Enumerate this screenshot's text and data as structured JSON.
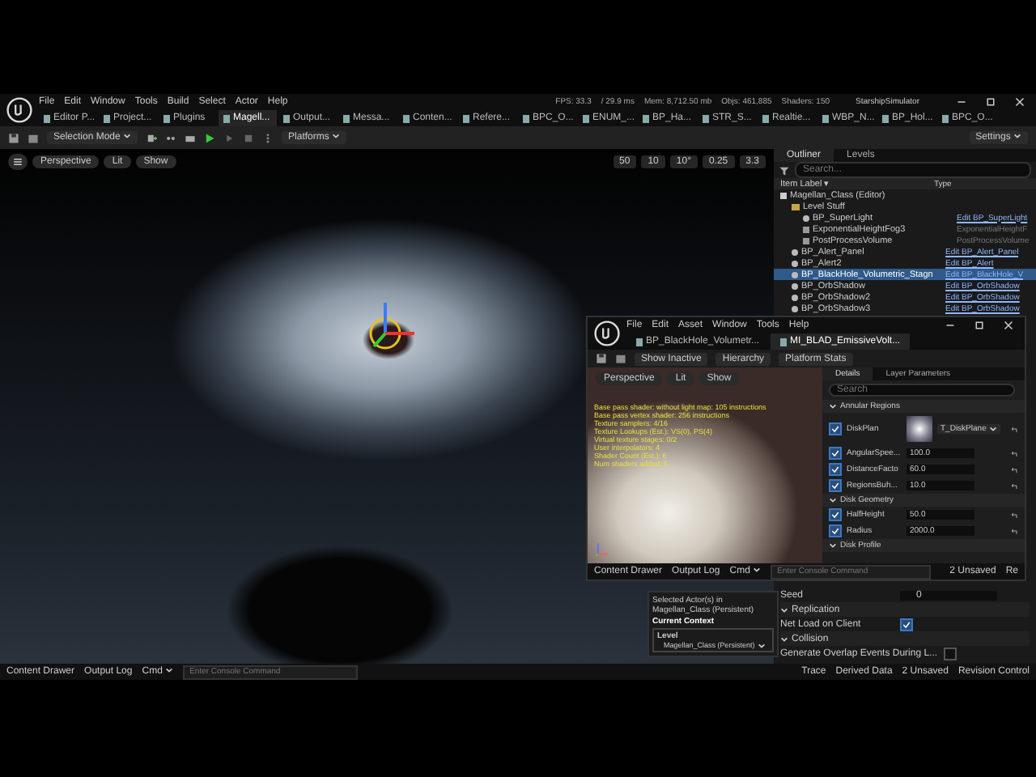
{
  "menu": [
    "File",
    "Edit",
    "Window",
    "Tools",
    "Build",
    "Select",
    "Actor",
    "Help"
  ],
  "stats": [
    "FPS: 33.3",
    "/ 29.9 ms",
    "Mem: 8,712.50 mb",
    "Objs: 461,885",
    "Shaders: 150"
  ],
  "project": "StarshipSimulator",
  "doc_tabs": [
    {
      "label": "Editor P...",
      "selected": false
    },
    {
      "label": "Project...",
      "selected": false
    },
    {
      "label": "Plugins",
      "selected": false
    },
    {
      "label": "Magell...",
      "selected": true
    },
    {
      "label": "Output...",
      "selected": false
    },
    {
      "label": "Messa...",
      "selected": false
    },
    {
      "label": "Conten...",
      "selected": false
    },
    {
      "label": "Refere...",
      "selected": false
    },
    {
      "label": "BPC_O...",
      "selected": false
    },
    {
      "label": "ENUM_...",
      "selected": false
    },
    {
      "label": "BP_Ha...",
      "selected": false
    },
    {
      "label": "STR_S...",
      "selected": false
    },
    {
      "label": "Realtie...",
      "selected": false
    },
    {
      "label": "WBP_N...",
      "selected": false
    },
    {
      "label": "BP_Hol...",
      "selected": false
    },
    {
      "label": "BPC_O...",
      "selected": false
    }
  ],
  "toolbar": {
    "mode": "Selection Mode",
    "platforms": "Platforms",
    "settings": "Settings"
  },
  "viewport": {
    "buttons": [
      "Perspective",
      "Lit",
      "Show"
    ],
    "readouts": [
      "50",
      "10",
      "10°",
      "0.25",
      "3.3"
    ]
  },
  "outliner": {
    "tabs": [
      {
        "label": "Outliner",
        "selected": true
      },
      {
        "label": "Levels",
        "selected": false
      }
    ],
    "search_placeholder": "Search...",
    "columns": [
      "Item Label ▾",
      "Type"
    ],
    "items": [
      {
        "label": "Magellan_Class (Editor)",
        "kind": "level",
        "selected": false,
        "children": [
          {
            "label": "Level Stuff",
            "kind": "folder",
            "selected": false,
            "children": [
              {
                "label": "BP_SuperLight",
                "kind": "actor",
                "type": "Edit BP_SuperLight",
                "link": true,
                "selected": false
              },
              {
                "label": "ExponentialHeightFog3",
                "kind": "fog",
                "type": "ExponentialHeightF",
                "link": false,
                "selected": false
              },
              {
                "label": "PostProcessVolume",
                "kind": "volume",
                "type": "PostProcessVolume",
                "link": false,
                "selected": false
              }
            ]
          },
          {
            "label": "BP_Alert_Panel",
            "kind": "actor",
            "type": "Edit BP_Alert_Panel",
            "link": true,
            "selected": false
          },
          {
            "label": "BP_Alert2",
            "kind": "actor",
            "type": "Edit BP_Alert",
            "link": true,
            "selected": false
          },
          {
            "label": "BP_BlackHole_Volumetric_Stagn",
            "kind": "actor",
            "type": "Edit BP_BlackHole_V",
            "link": true,
            "selected": true
          },
          {
            "label": "BP_OrbShadow",
            "kind": "actor",
            "type": "Edit BP_OrbShadow",
            "link": true,
            "selected": false
          },
          {
            "label": "BP_OrbShadow2",
            "kind": "actor",
            "type": "Edit BP_OrbShadow",
            "link": true,
            "selected": false
          },
          {
            "label": "BP_OrbShadow3",
            "kind": "actor",
            "type": "Edit BP_OrbShadow",
            "link": true,
            "selected": false
          }
        ]
      }
    ]
  },
  "details": [
    {
      "kind": "value",
      "label": "Seed",
      "value": "0"
    },
    {
      "kind": "section",
      "label": "Replication"
    },
    {
      "kind": "check",
      "label": "Net Load on Client",
      "checked": true
    },
    {
      "kind": "section",
      "label": "Collision"
    },
    {
      "kind": "check",
      "label": "Generate Overlap Events During L...",
      "checked": false
    }
  ],
  "status_bar": {
    "left": [
      "Content Drawer",
      "Output Log"
    ],
    "cmd": "Cmd",
    "console_placeholder": "Enter Console Command",
    "right": [
      "Trace",
      "Derived Data",
      "2 Unsaved",
      "Revision Control"
    ]
  },
  "popup": {
    "text": "Selected Actor(s) in Magellan_Class (Persistent)",
    "heading": "Current Context",
    "level_label": "Level",
    "level_value": "Magellan_Class (Persistent)"
  },
  "material_editor": {
    "menu": [
      "File",
      "Edit",
      "Asset",
      "Window",
      "Tools",
      "Help"
    ],
    "tabs": [
      {
        "label": "BP_BlackHole_Volumetr...",
        "selected": false
      },
      {
        "label": "MI_BLAD_EmissiveVolt...",
        "selected": true
      }
    ],
    "toolbar": [
      "Show Inactive",
      "Hierarchy",
      "Platform Stats"
    ],
    "viewport_buttons": [
      "Perspective",
      "Lit",
      "Show"
    ],
    "stat_lines": [
      "Base pass shader: without light map: 105 instructions",
      "Base pass vertex shader: 256 instructions",
      "Texture samplers: 4/16",
      "Texture Lookups (Est.): VS(0), PS(4)",
      "Virtual texture stages: 0/2",
      "User interpolators: 4",
      "Shader Count (Est.): 6",
      "Num shaders added: 6"
    ],
    "details_tabs": [
      {
        "label": "Details",
        "selected": true
      },
      {
        "label": "Layer Parameters",
        "selected": false
      }
    ],
    "search_placeholder": "Search",
    "groups": [
      {
        "label": "Annular Regions",
        "params": [
          {
            "kind": "texture",
            "label": "DiskPlan",
            "value": "T_DiskPlane",
            "checked": true
          },
          {
            "kind": "number",
            "label": "AngularSpee...",
            "value": "100.0",
            "checked": true
          },
          {
            "kind": "number",
            "label": "DistanceFacto",
            "value": "60.0",
            "checked": true
          },
          {
            "kind": "number",
            "label": "RegionsBuh...",
            "value": "10.0",
            "checked": true
          }
        ]
      },
      {
        "label": "Disk Geometry",
        "params": [
          {
            "kind": "number",
            "label": "HalfHeight",
            "value": "50.0",
            "checked": true
          },
          {
            "kind": "number",
            "label": "Radius",
            "value": "2000.0",
            "checked": true
          }
        ]
      },
      {
        "label": "Disk Profile"
      }
    ],
    "status_left": [
      "Content Drawer",
      "Output Log"
    ],
    "cmd": "Cmd",
    "console_placeholder": "Enter Console Command",
    "status_right": [
      "2 Unsaved",
      "Re"
    ]
  }
}
